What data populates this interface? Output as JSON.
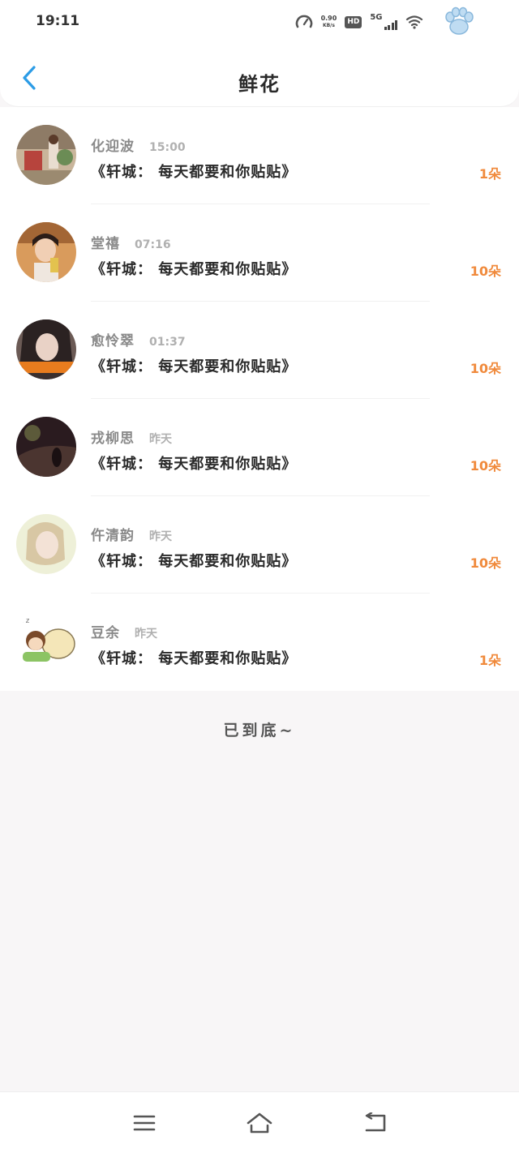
{
  "status_bar": {
    "time": "19:11",
    "net_speed": "0.90",
    "net_speed_unit": "KB/s",
    "hd_label": "HD",
    "network_label": "5G"
  },
  "header": {
    "title": "鲜花",
    "back_icon": "chevron-left-icon",
    "accent_color": "#2c9ce6"
  },
  "gifts": [
    {
      "name": "化迎波",
      "time": "15:00",
      "text": "《轩城： 每天都要和你贴贴》",
      "count": "1朵"
    },
    {
      "name": "堂禧",
      "time": "07:16",
      "text": "《轩城： 每天都要和你贴贴》",
      "count": "10朵"
    },
    {
      "name": "愈怜翠",
      "time": "01:37",
      "text": "《轩城： 每天都要和你贴贴》",
      "count": "10朵"
    },
    {
      "name": "戎柳思",
      "time": "昨天",
      "text": "《轩城： 每天都要和你贴贴》",
      "count": "10朵"
    },
    {
      "name": "仵清韵",
      "time": "昨天",
      "text": "《轩城： 每天都要和你贴贴》",
      "count": "10朵"
    },
    {
      "name": "豆余",
      "time": "昨天",
      "text": "《轩城： 每天都要和你贴贴》",
      "count": "1朵"
    }
  ],
  "footer": {
    "end_text": "已到底~"
  },
  "colors": {
    "count": "#f08a3c",
    "background": "#f8f6f7"
  }
}
